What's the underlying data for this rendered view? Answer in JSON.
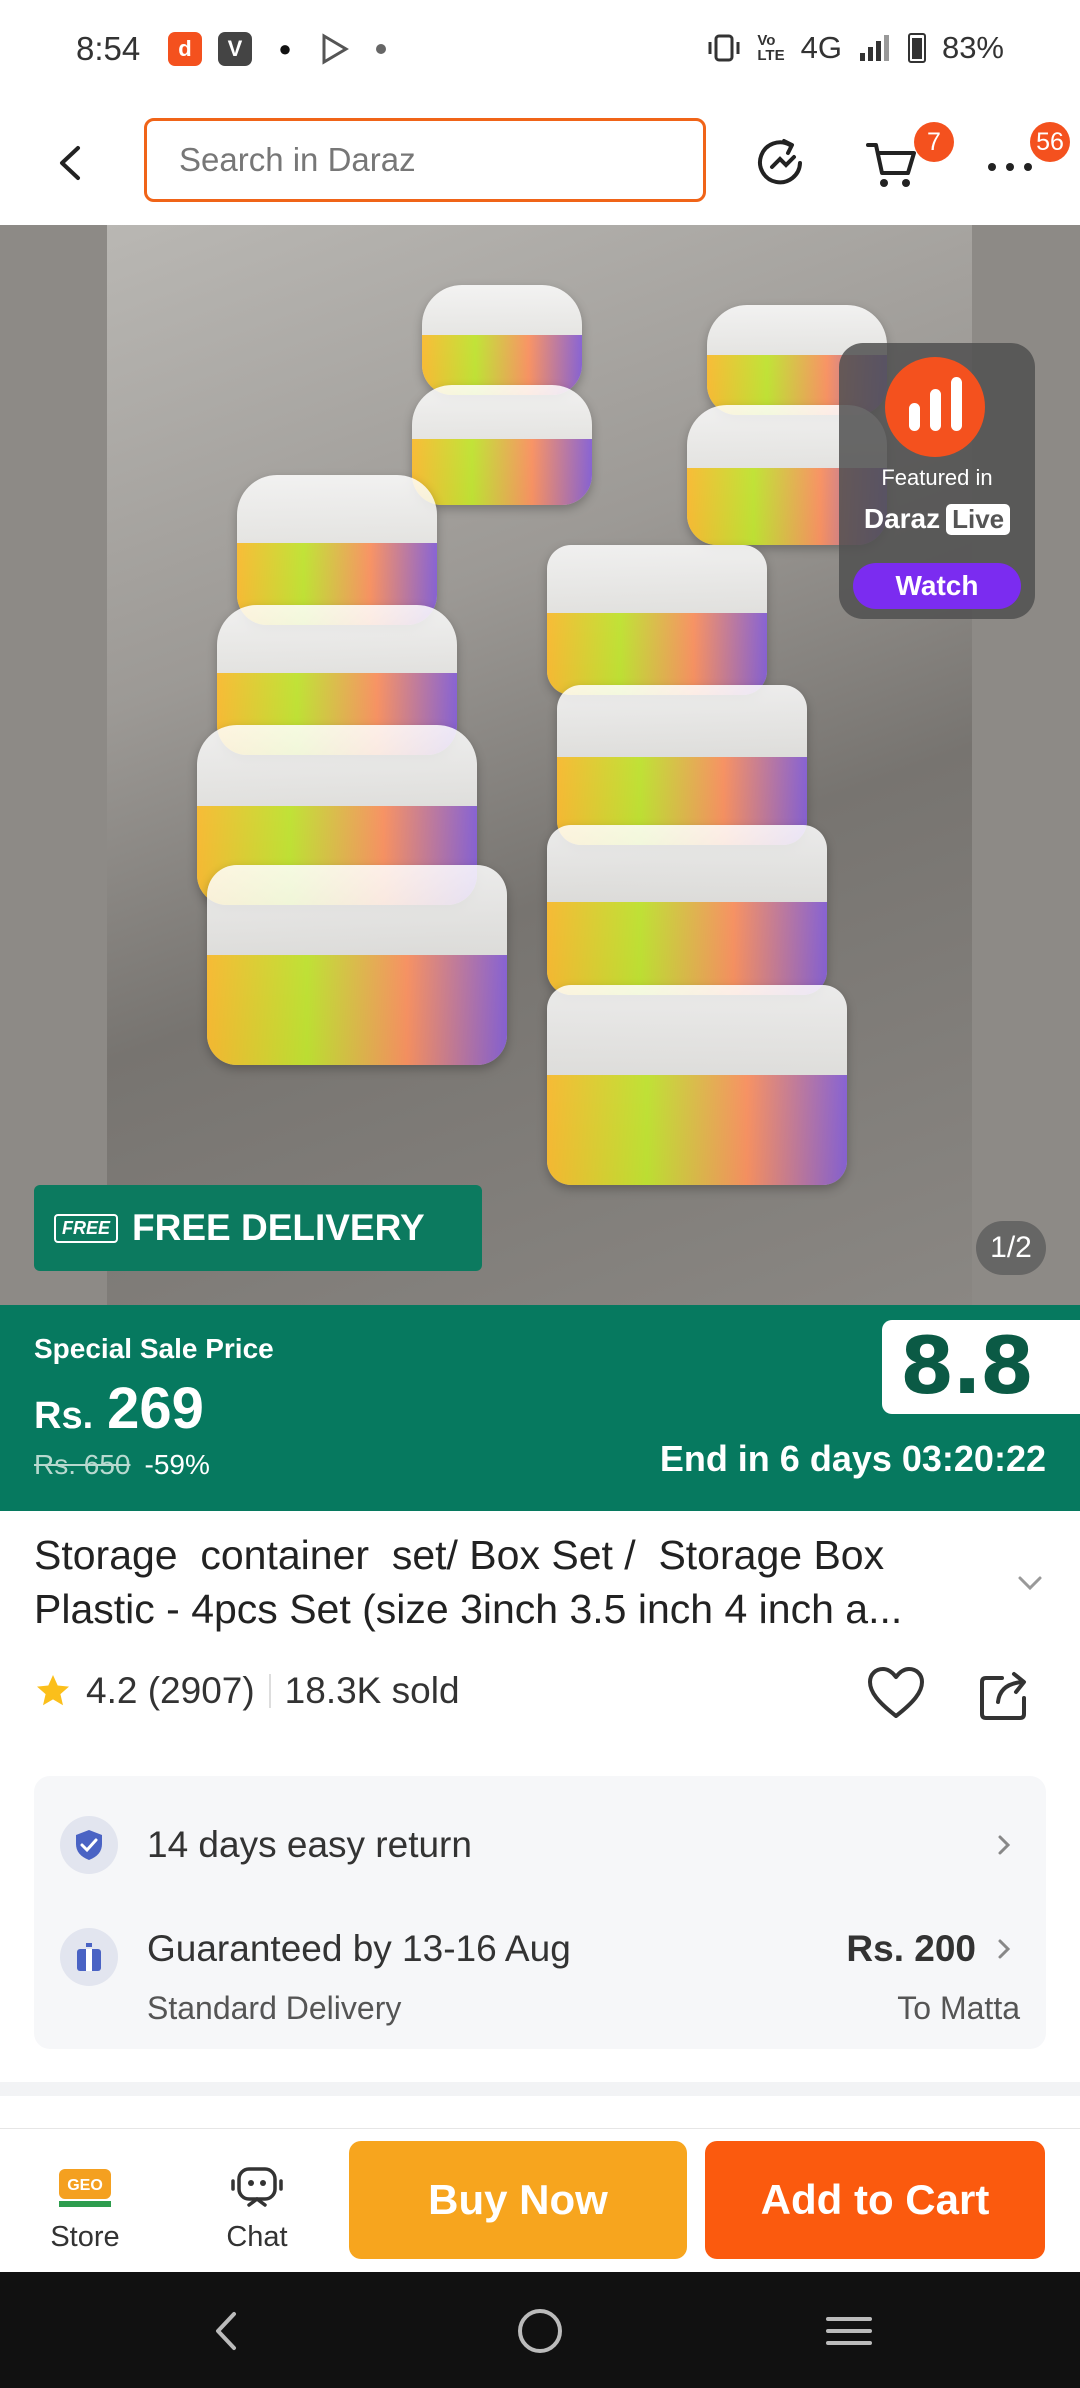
{
  "status_bar": {
    "time": "8:54",
    "network": "4G",
    "battery": "83%",
    "app_icons": [
      "daraz-app-icon",
      "v-app-icon",
      "music-app-icon",
      "play-store-icon"
    ]
  },
  "header": {
    "search_placeholder": "Search in Daraz",
    "cart_count": "7",
    "more_count": "56"
  },
  "gallery": {
    "live": {
      "featured_label": "Featured in",
      "brand": "Daraz",
      "brand_box": "Live",
      "watch_label": "Watch"
    },
    "free_delivery_tag": "FREE",
    "free_delivery_label": "FREE DELIVERY",
    "counter": "1/2"
  },
  "sale": {
    "label": "Special Sale Price",
    "currency": "Rs.",
    "price": "269",
    "original_price": "Rs. 650",
    "discount": "-59%",
    "event_badge": "8.8",
    "countdown": "End in 6 days 03:20:22"
  },
  "product": {
    "title_line1": "Storage  container  set/ Box Set /  Storage Box",
    "title_line2": "Plastic - 4pcs Set (size 3inch 3.5 inch 4 inch a...",
    "rating": "4.2 (2907)",
    "sold": "18.3K sold"
  },
  "services": {
    "return_label": "14 days easy return",
    "delivery_label": "Guaranteed by 13-16 Aug",
    "delivery_sub": "Standard Delivery",
    "delivery_price": "Rs. 200",
    "delivery_to": "To Matta"
  },
  "bottom_bar": {
    "store_label": "Store",
    "chat_label": "Chat",
    "buy_now_label": "Buy Now",
    "add_to_cart_label": "Add to Cart"
  },
  "colors": {
    "brand_orange": "#f4511e",
    "sale_green": "#06795f",
    "buy_now": "#f7a51e",
    "add_to_cart": "#fb5a0e"
  }
}
